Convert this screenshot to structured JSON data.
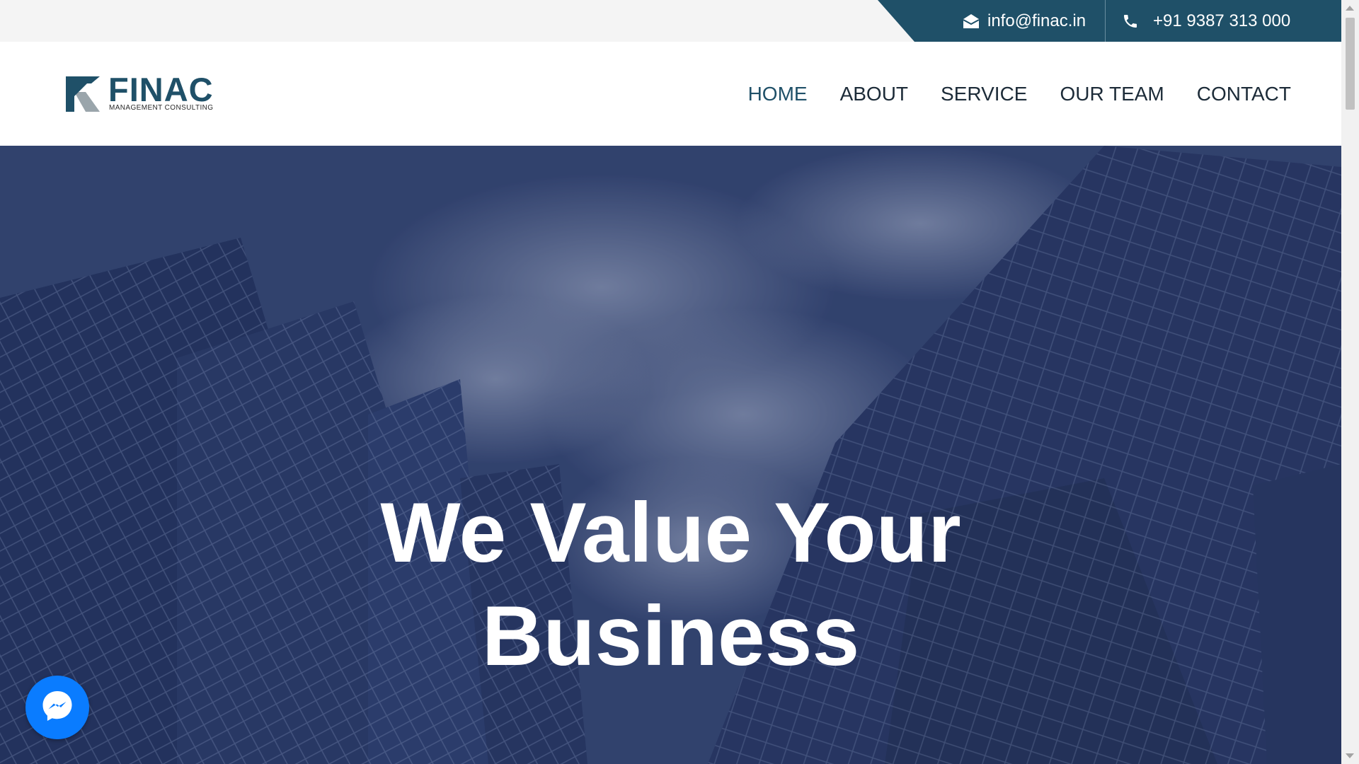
{
  "topbar": {
    "email_icon": "envelope-open-icon",
    "email": "info@finac.in",
    "phone_icon": "phone-icon",
    "phone": "+91 9387 313 000"
  },
  "logo": {
    "name": "FINAC",
    "tagline": "MANAGEMENT CONSULTING"
  },
  "nav": {
    "items": [
      {
        "label": "HOME",
        "active": true
      },
      {
        "label": "ABOUT",
        "active": false
      },
      {
        "label": "SERVICE",
        "active": false
      },
      {
        "label": "OUR TEAM",
        "active": false
      },
      {
        "label": "CONTACT",
        "active": false
      }
    ]
  },
  "hero": {
    "heading_line1": "We Value Your",
    "heading_line2": "Business"
  },
  "messenger": {
    "icon": "messenger-icon"
  },
  "colors": {
    "brand": "#1f5068",
    "topbar_bg": "#f4f4f4",
    "hero_overlay": "#2e3d66",
    "messenger": "#0a7cff"
  }
}
